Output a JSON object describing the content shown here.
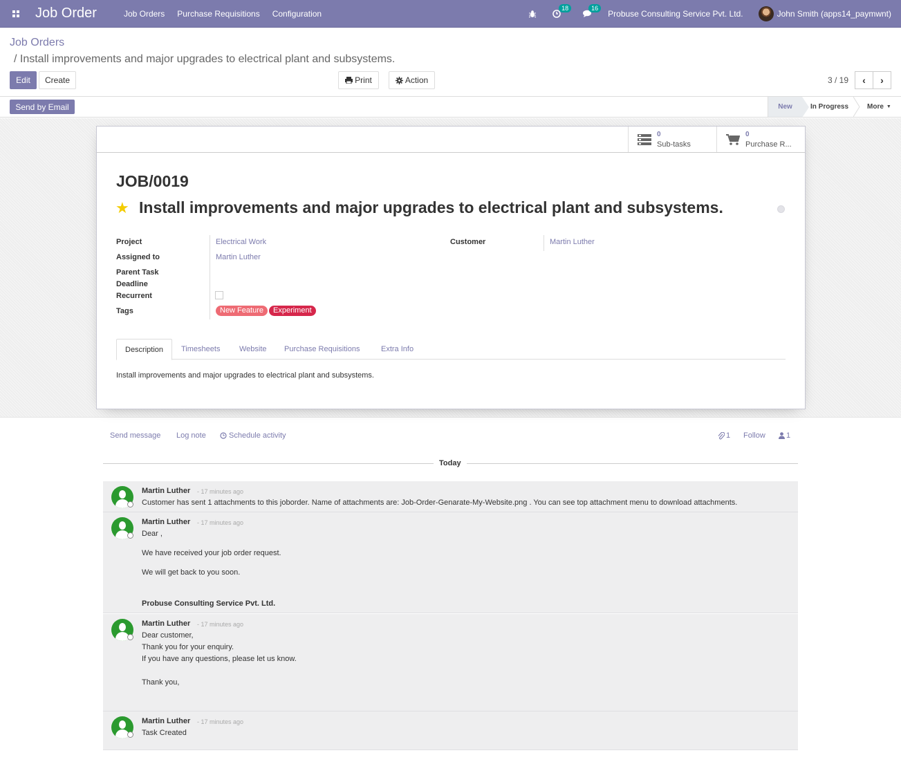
{
  "navbar": {
    "app_title": "Job Order",
    "menu": [
      "Job Orders",
      "Purchase Requisitions",
      "Configuration"
    ],
    "activity_count": "18",
    "message_count": "16",
    "company": "Probuse Consulting Service Pvt. Ltd.",
    "user": "John Smith (apps14_paymwnt)"
  },
  "breadcrumb": {
    "root": "Job Orders",
    "current": "/ Install improvements and major upgrades to electrical plant and subsystems."
  },
  "buttons": {
    "edit": "Edit",
    "create": "Create",
    "print": "Print",
    "action": "Action",
    "send_email": "Send by Email"
  },
  "pager": {
    "text": "3 / 19"
  },
  "stages": {
    "new": "New",
    "in_progress": "In Progress",
    "more": "More"
  },
  "stat_buttons": {
    "subtasks_value": "0",
    "subtasks_label": "Sub-tasks",
    "purchase_value": "0",
    "purchase_label": "Purchase R..."
  },
  "record": {
    "id": "JOB/0019",
    "title": "Install improvements and major upgrades to electrical plant and subsystems.",
    "fields": {
      "project_label": "Project",
      "project_value": "Electrical Work",
      "assigned_label": "Assigned to",
      "assigned_value": "Martin Luther",
      "parent_label": "Parent Task",
      "deadline_label": "Deadline",
      "recurrent_label": "Recurrent",
      "tags_label": "Tags",
      "customer_label": "Customer",
      "customer_value": "Martin Luther"
    },
    "tags": [
      {
        "label": "New Feature",
        "color": "#ee6b74"
      },
      {
        "label": "Experiment",
        "color": "#d6274b"
      }
    ]
  },
  "tabs": [
    "Description",
    "Timesheets",
    "Website",
    "Purchase Requisitions",
    "Extra Info"
  ],
  "description": "Install improvements and major upgrades to electrical plant and subsystems.",
  "chatter": {
    "send_message": "Send message",
    "log_note": "Log note",
    "schedule_activity": "Schedule activity",
    "attachments_count": "1",
    "follow": "Follow",
    "followers_count": "1",
    "today": "Today"
  },
  "messages": [
    {
      "author": "Martin Luther",
      "date": "- 17 minutes ago",
      "lines": [
        "Customer has sent 1 attachments to this joborder. Name of attachments are: Job-Order-Genarate-My-Website.png . You can see top attachment menu to download attachments."
      ]
    },
    {
      "author": "Martin Luther",
      "date": "- 17 minutes ago",
      "lines": [
        "Dear ,",
        "We have received your job order request.",
        "We will get back to you soon.",
        "Probuse Consulting Service Pvt. Ltd."
      ]
    },
    {
      "author": "Martin Luther",
      "date": "- 17 minutes ago",
      "lines": [
        "Dear customer,",
        "Thank you for your enquiry.",
        "If you have any questions, please let us know.",
        "Thank you,"
      ]
    },
    {
      "author": "Martin Luther",
      "date": "- 17 minutes ago",
      "lines": [
        "Task Created"
      ]
    }
  ],
  "colors": {
    "primary": "#7c7bad",
    "star": "#f3cc00",
    "avatar_green": "#2b9a2f"
  }
}
